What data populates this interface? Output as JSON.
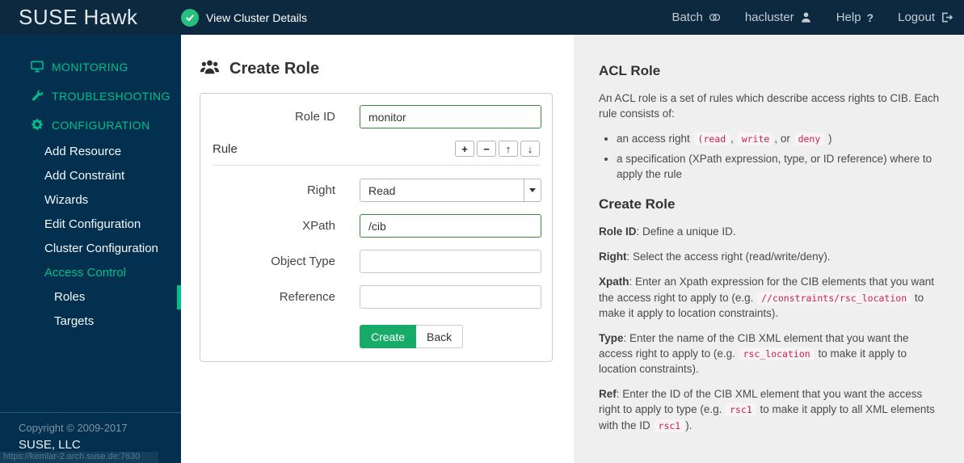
{
  "colors": {
    "topbar_bg": "#0d2940",
    "sidebar_bg": "#04304f",
    "accent_green": "#00bf8a",
    "status_badge_green": "#28bf7e",
    "create_button_green": "#17ab68",
    "focused_input_border": "#3a8a3d",
    "help_bg": "#efefef",
    "code_text": "#c7254e"
  },
  "topbar": {
    "logo": "SUSE Hawk",
    "cluster_status": "View Cluster Details",
    "batch_label": "Batch",
    "username": "hacluster",
    "help_label": "Help",
    "help_icon_glyph": "?",
    "logout_label": "Logout"
  },
  "sidebar": {
    "items": [
      {
        "label": "MONITORING"
      },
      {
        "label": "TROUBLESHOOTING"
      },
      {
        "label": "CONFIGURATION"
      },
      {
        "label": "Add Resource"
      },
      {
        "label": "Add Constraint"
      },
      {
        "label": "Wizards"
      },
      {
        "label": "Edit Configuration"
      },
      {
        "label": "Cluster Configuration"
      },
      {
        "label": "Access Control"
      },
      {
        "label": "Roles"
      },
      {
        "label": "Targets"
      }
    ],
    "copyright": "Copyright © 2009-2017",
    "company": "SUSE, LLC",
    "status_url": "https://kemlar-2.arch.suse.de:7630"
  },
  "main": {
    "title": "Create Role",
    "form": {
      "role_id_label": "Role ID",
      "role_id_value": "monitor",
      "rule_label": "Rule",
      "rule_buttons": [
        {
          "glyph": "+"
        },
        {
          "glyph": "−"
        },
        {
          "glyph": "↑"
        },
        {
          "glyph": "↓"
        }
      ],
      "right_label": "Right",
      "right_value": "Read",
      "xpath_label": "XPath",
      "xpath_value": "/cib",
      "object_type_label": "Object Type",
      "object_type_value": "",
      "reference_label": "Reference",
      "reference_value": "",
      "create_label": "Create",
      "back_label": "Back"
    }
  },
  "help": {
    "acl_title": "ACL Role",
    "acl_intro": "An ACL role is a set of rules which describe access rights to CIB. Each rule consists of:",
    "bullet1": {
      "pre": "an access right ",
      "code1": "(read",
      "sep1": ", ",
      "code2": "write",
      "sep2": ", or ",
      "code3": "deny",
      "post": " )"
    },
    "bullet2": "a specification (XPath expression, type, or ID reference) where to apply the rule",
    "create_title": "Create Role",
    "p_role": {
      "term": "Role ID",
      "text": ": Define a unique ID."
    },
    "p_right": {
      "term": "Right",
      "text": ": Select the access right (read/write/deny)."
    },
    "p_xpath": {
      "term": "Xpath",
      "pre": ": Enter an Xpath expression for the CIB elements that you want the access right to apply to (e.g. ",
      "code": "//constraints/rsc_location",
      "post": " to make it apply to location constraints)."
    },
    "p_type": {
      "term": "Type",
      "pre": ": Enter the name of the CIB XML element that you want the access right to apply to (e.g. ",
      "code": "rsc_location",
      "post": " to make it apply to location constraints)."
    },
    "p_ref": {
      "term": "Ref",
      "pre": ": Enter the ID of the CIB XML element that you want the access right to apply to type (e.g. ",
      "code1": "rsc1",
      "mid": " to make it apply to all XML elements with the ID ",
      "code2": "rsc1",
      "post": ")."
    }
  }
}
